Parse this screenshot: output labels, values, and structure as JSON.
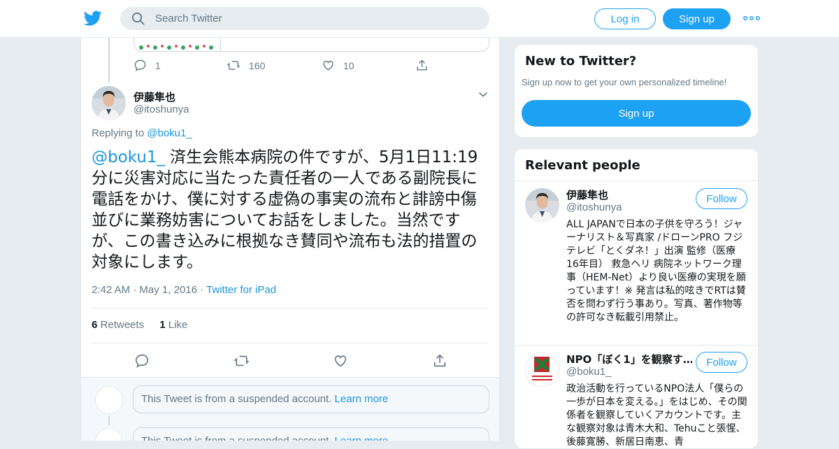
{
  "header": {
    "search_placeholder": "Search Twitter",
    "login_label": "Log in",
    "signup_label": "Sign up"
  },
  "prev_tweet_actions": {
    "reply_count": "1",
    "retweet_count": "160",
    "like_count": "10"
  },
  "tweet": {
    "author_name": "伊藤隼也",
    "author_handle": "@itoshunya",
    "replying_to_label": "Replying to",
    "replying_to_handle": "@boku1_",
    "mention": "@boku1_",
    "text": " 済生会熊本病院の件ですが、5月1日11:19分に災害対応に当たった責任者の一人である副院長に電話をかけ、僕に対する虚偽の事実の流布と誹謗中傷並びに業務妨害についてお話をしました。当然ですが、この書き込みに根拠なき賛同や流布も法的措置の対象にします。",
    "time": "2:42 AM",
    "date": "May 1, 2016",
    "source": "Twitter for iPad",
    "sep": "·",
    "retweets_count": "6",
    "retweets_label": "Retweets",
    "likes_count": "1",
    "likes_label": "Like"
  },
  "suspended": {
    "text": "This Tweet is from a suspended account.",
    "learn_more": "Learn more"
  },
  "sidebar": {
    "new_title": "New to Twitter?",
    "new_sub": "Sign up now to get your own personalized timeline!",
    "signup_label": "Sign up",
    "relevant_title": "Relevant people",
    "people": [
      {
        "name": "伊藤隼也",
        "handle": "@itoshunya",
        "follow": "Follow",
        "bio": "ALL JAPANで日本の子供を守ろう！ジャーナリスト＆写真家 /ドローンPRO フジテレビ「とくダネ！」出演 監修（医療 16年目） 救急ヘリ 病院ネットワーク理事（HEM-Net）より良い医療の実現を願っています！※ 発言は私的呟きでRTは賛否を問わず行う事あり。写真、著作物等の許可なき転載引用禁止。"
      },
      {
        "name": "NPO「ぼく1」を観察す…",
        "handle": "@boku1_",
        "follow": "Follow",
        "bio": "政治活動を行っているNPO法人「僕らの一歩が日本を変える。」をはじめ、その関係者を観察していくアカウントです。主な観察対象は青木大和、Tehuこと張惺、後藤寛勝、新居日南恵、青"
      }
    ]
  },
  "colors": {
    "accent": "#1da1f2",
    "link": "#1b95e0",
    "muted": "#657786",
    "bg": "#e6ecf0"
  }
}
